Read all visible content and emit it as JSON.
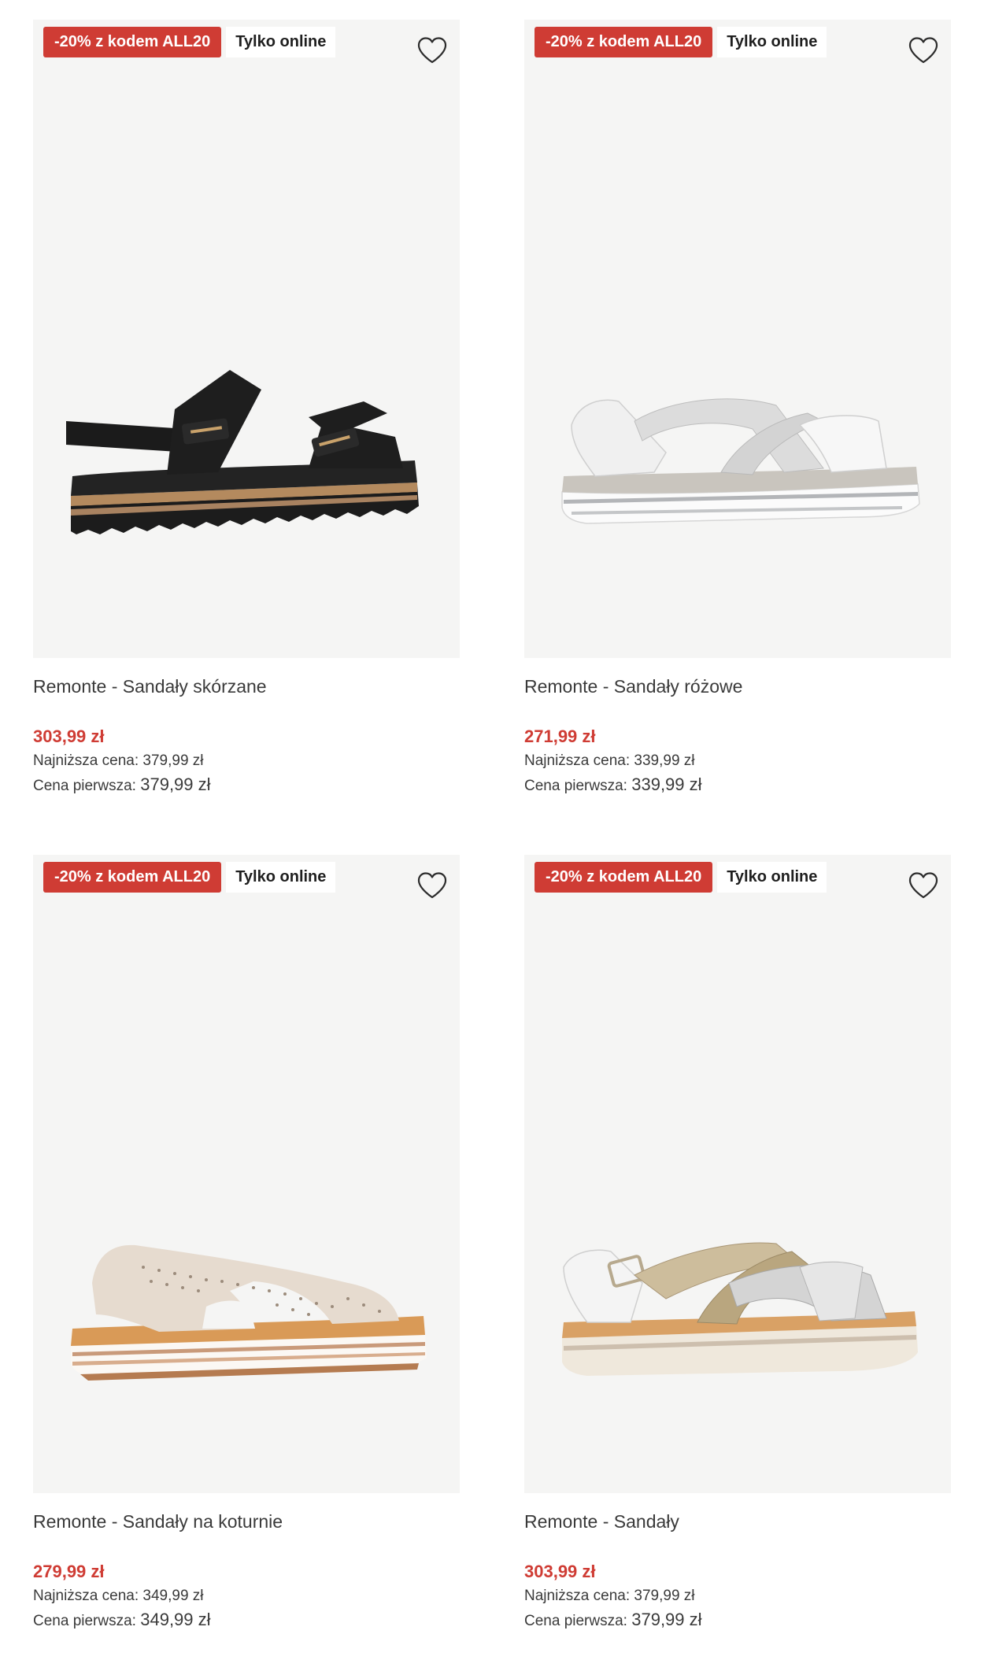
{
  "products": [
    {
      "promo_badge": "-20% z kodem ALL20",
      "online_badge": "Tylko online",
      "title": "Remonte - Sandały skórzane",
      "price": "303,99 zł",
      "lowest_label": "Najniższa cena:",
      "lowest_value": "379,99 zł",
      "first_label": "Cena pierwsza:",
      "first_value": "379,99 zł",
      "image_icon": "black-leather-sandal-image"
    },
    {
      "promo_badge": "-20% z kodem ALL20",
      "online_badge": "Tylko online",
      "title": "Remonte - Sandały różowe",
      "price": "271,99 zł",
      "lowest_label": "Najniższa cena:",
      "lowest_value": "339,99 zł",
      "first_label": "Cena pierwsza:",
      "first_value": "339,99 zł",
      "image_icon": "white-crossed-sandal-image"
    },
    {
      "promo_badge": "-20% z kodem ALL20",
      "online_badge": "Tylko online",
      "title": "Remonte - Sandały na koturnie",
      "price": "279,99 zł",
      "lowest_label": "Najniższa cena:",
      "lowest_value": "349,99 zł",
      "first_label": "Cena pierwsza:",
      "first_value": "349,99 zł",
      "image_icon": "beige-knit-sandal-image"
    },
    {
      "promo_badge": "-20% z kodem ALL20",
      "online_badge": "Tylko online",
      "title": "Remonte - Sandały",
      "price": "303,99 zł",
      "lowest_label": "Najniższa cena:",
      "lowest_value": "379,99 zł",
      "first_label": "Cena pierwsza:",
      "first_value": "379,99 zł",
      "image_icon": "metallic-strap-sandal-image"
    }
  ],
  "colors": {
    "promo": "#cf3c34",
    "image_bg": "#f5f5f4",
    "text": "#3a3a3a"
  }
}
